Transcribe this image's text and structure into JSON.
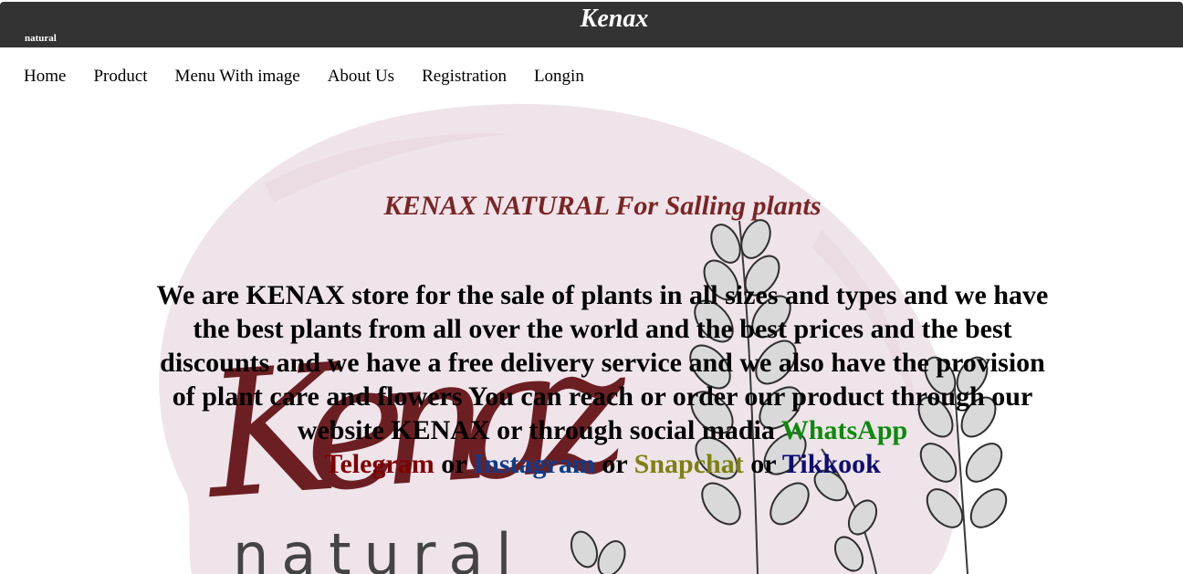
{
  "header": {
    "title": "Kenax",
    "subtitle": "natural"
  },
  "nav": {
    "items": [
      {
        "label": "Home"
      },
      {
        "label": "Product"
      },
      {
        "label": "Menu With image"
      },
      {
        "label": "About Us"
      },
      {
        "label": "Registration"
      },
      {
        "label": "Longin"
      }
    ]
  },
  "hero": {
    "title": "KENAX NATURAL For Salling plants",
    "description": "We are KENAX store for the sale of plants in all sizes and types and we have the best plants from all over the world and the best prices and the best discounts and we have a free delivery service and we also have the provision of plant care and flowers You can reach or order our product through our website KENAX or through social madia ",
    "social": {
      "whatsapp": "WhatsApp",
      "telegram": "Telegram",
      "instagram": "Instagram",
      "snapchat": "Snapchat",
      "tiktok": "Tikkook",
      "separator": " or "
    },
    "background_logo": {
      "word": "Kenaz",
      "sub": "natural"
    }
  },
  "colors": {
    "header_bg": "#333333",
    "title_color": "#7b2424",
    "blob_color": "#efe4ea",
    "logo_red": "#5e0a0e",
    "whatsapp": "#0b8a0b",
    "telegram": "#800000",
    "instagram": "#0d3c8a",
    "snapchat": "#7f7f10",
    "tiktok": "#0c0c73"
  }
}
